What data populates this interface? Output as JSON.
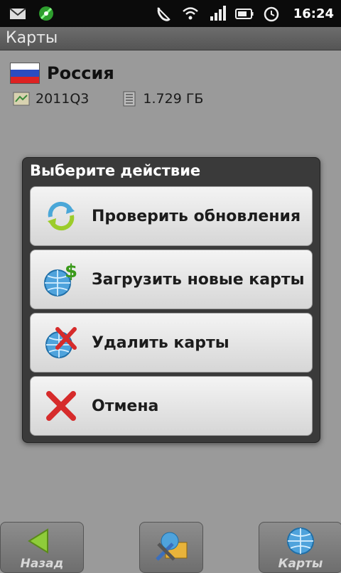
{
  "status_bar": {
    "time": "16:24",
    "icons": [
      "email-icon",
      "gps-satellite-icon",
      "no-call-icon",
      "wifi-icon",
      "signal-icon",
      "battery-icon",
      "alarm-icon"
    ]
  },
  "title_bar": {
    "title": "Карты"
  },
  "map_info": {
    "country": "Россия",
    "version": "2011Q3",
    "size": "1.729 ГБ"
  },
  "dialog": {
    "title": "Выберите действие",
    "options": [
      {
        "label": "Проверить обновления",
        "icon": "refresh-icon"
      },
      {
        "label": "Загрузить новые карты",
        "icon": "globe-dollar-icon"
      },
      {
        "label": "Удалить карты",
        "icon": "globe-delete-icon"
      },
      {
        "label": "Отмена",
        "icon": "cancel-icon"
      }
    ]
  },
  "bottom_bar": {
    "back_label": "Назад",
    "maps_label": "Карты"
  },
  "colors": {
    "status_bar": "#0b0b0b",
    "dialog": "#3a3a3a",
    "background": "#9a9a9a"
  }
}
